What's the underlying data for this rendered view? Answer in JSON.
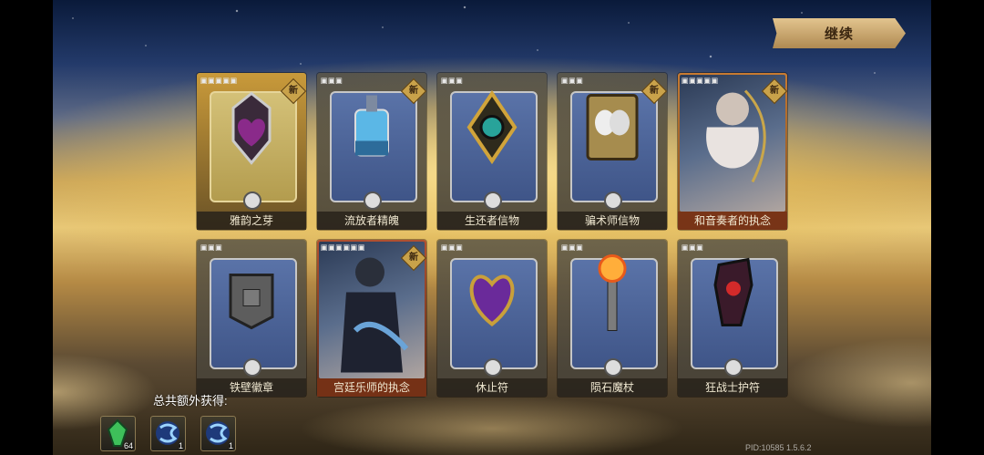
{
  "header": {
    "continue_label": "继续"
  },
  "cards": [
    {
      "name": "雅韵之芽",
      "stars": "🞕🞕🞕🞕🞕",
      "new": true,
      "style": "gold-frame",
      "inner": "gold",
      "icon": "heart-amulet-icon"
    },
    {
      "name": "流放者精魄",
      "stars": "🞕🞕🞕",
      "new": true,
      "style": "",
      "inner": "",
      "icon": "potion-bottle-icon"
    },
    {
      "name": "生还者信物",
      "stars": "🞕🞕🞕",
      "new": false,
      "style": "",
      "inner": "",
      "icon": "eye-emblem-icon"
    },
    {
      "name": "骗术师信物",
      "stars": "🞕🞕🞕",
      "new": true,
      "style": "",
      "inner": "",
      "icon": "mask-book-icon"
    },
    {
      "name": "和音奏者的执念",
      "stars": "🞕🞕🞕🞕🞕",
      "new": true,
      "style": "orange",
      "inner": "portrait",
      "icon": "harpist-portrait"
    },
    {
      "name": "铁壁徽章",
      "stars": "🞕🞕🞕",
      "new": false,
      "style": "",
      "inner": "",
      "icon": "stone-badge-icon"
    },
    {
      "name": "宫廷乐师的执念",
      "stars": "🞕🞕🞕🞕🞕🞕",
      "new": true,
      "style": "red",
      "inner": "portrait",
      "icon": "musician-portrait"
    },
    {
      "name": "休止符",
      "stars": "🞕🞕🞕",
      "new": false,
      "style": "",
      "inner": "",
      "icon": "purple-heart-icon"
    },
    {
      "name": "陨石魔杖",
      "stars": "🞕🞕🞕",
      "new": false,
      "style": "",
      "inner": "",
      "icon": "meteor-wand-icon"
    },
    {
      "name": "狂战士护符",
      "stars": "🞕🞕🞕",
      "new": false,
      "style": "",
      "inner": "",
      "icon": "crimson-charm-icon"
    }
  ],
  "new_badge_label": "新",
  "total_label": "总共额外获得:",
  "rewards": [
    {
      "icon": "green-crystal-icon",
      "count": "64"
    },
    {
      "icon": "blue-sigil-icon",
      "count": "1"
    },
    {
      "icon": "blue-sigil-icon",
      "count": "1"
    }
  ],
  "version": "PID:10585 1.5.6.2"
}
